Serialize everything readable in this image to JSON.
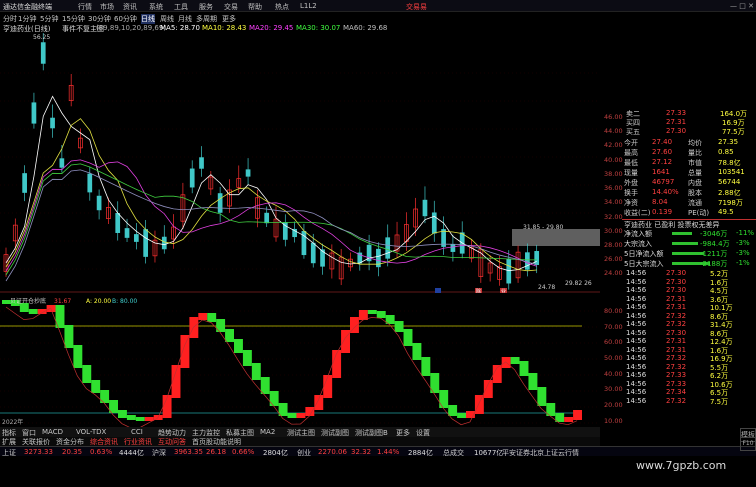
{
  "titlebar": {
    "app": "通达信金融终端",
    "menus": [
      "行情",
      "市场",
      "资讯",
      "系统",
      "工具",
      "服务",
      "交易",
      "帮助",
      "热点",
      "L1L2"
    ],
    "trade": "交易易"
  },
  "toolbar": {
    "items": [
      "分时",
      "1分钟",
      "5分钟",
      "15分钟",
      "30分钟",
      "60分钟",
      "日线",
      "周线",
      "月线",
      "多周期",
      "更多"
    ]
  },
  "infobar": {
    "stock": "亨迪药业(日线)",
    "mode": "事件不复主图",
    "params": "(89,89,10,20,89,69)",
    "ma5": "MA5: 28.70",
    "ma10": "MA10: 28.43",
    "ma20": "MA20: 29.45",
    "ma30": "MA30: 30.07",
    "ma60": "MA60: 29.68",
    "high_label": "56.25"
  },
  "axis": {
    "price": [
      "46.00",
      "44.00",
      "42.00",
      "40.00",
      "38.00",
      "36.00",
      "34.00",
      "32.00",
      "30.00",
      "28.00",
      "26.00",
      "24.00"
    ],
    "ind": [
      "80.00",
      "70.00",
      "60.00",
      "50.00",
      "40.00",
      "30.00",
      "20.00",
      "10.00"
    ],
    "extra": "29.82 26"
  },
  "annotations": {
    "range": "31.85 - 29.80",
    "low": "24.78",
    "marks": [
      "日",
      "除",
      "业"
    ]
  },
  "quote": {
    "asks": [
      {
        "l": "卖二",
        "p": "27.33",
        "v": "164.0万"
      },
      {
        "l": "买四",
        "p": "27.31",
        "v": "16.9万"
      },
      {
        "l": "买五",
        "p": "27.30",
        "v": "77.5万"
      }
    ],
    "rows": [
      {
        "a": "今开",
        "b": "27.40",
        "c": "均价",
        "d": "27.35"
      },
      {
        "a": "最高",
        "b": "27.60",
        "c": "量比",
        "d": "0.85"
      },
      {
        "a": "最低",
        "b": "27.12",
        "c": "市值",
        "d": "78.8亿"
      },
      {
        "a": "现量",
        "b": "1641",
        "c": "总量",
        "d": "103541"
      },
      {
        "a": "外盘",
        "b": "46797",
        "c": "内盘",
        "d": "56744"
      },
      {
        "a": "换手",
        "b": "14.40%",
        "c": "股本",
        "d": "2.88亿"
      },
      {
        "a": "净资",
        "b": "8.04",
        "c": "流通",
        "d": "7198万"
      },
      {
        "a": "收益(二)",
        "b": "0.139",
        "c": "PE(动)",
        "d": "49.5"
      }
    ],
    "company": "亨迪药业 已盈利 投票权无差异",
    "flows": [
      {
        "l": "净流入额",
        "v": "-3046万",
        "p": "-11%"
      },
      {
        "l": "大宗流入",
        "v": "-984.4万",
        "p": "-3%"
      },
      {
        "l": "5日净流入额",
        "v": "-1211万",
        "p": "-3%"
      },
      {
        "l": "5日大宗流入",
        "v": "-2188万",
        "p": "-1%"
      }
    ],
    "ticks": [
      {
        "t": "14:56",
        "p": "27.30",
        "v": "5.2万"
      },
      {
        "t": "14:56",
        "p": "27.30",
        "v": "1.6万"
      },
      {
        "t": "14:56",
        "p": "27.30",
        "v": "4.5万"
      },
      {
        "t": "14:56",
        "p": "27.31",
        "v": "3.6万"
      },
      {
        "t": "14:56",
        "p": "27.31",
        "v": "10.1万"
      },
      {
        "t": "14:56",
        "p": "27.32",
        "v": "8.6万"
      },
      {
        "t": "14:56",
        "p": "27.32",
        "v": "31.4万"
      },
      {
        "t": "14:56",
        "p": "27.30",
        "v": "8.6万"
      },
      {
        "t": "14:56",
        "p": "27.31",
        "v": "12.4万"
      },
      {
        "t": "14:56",
        "p": "27.31",
        "v": "1.6万"
      },
      {
        "t": "14:56",
        "p": "27.32",
        "v": "16.9万"
      },
      {
        "t": "14:56",
        "p": "27.32",
        "v": "5.5万"
      },
      {
        "t": "14:56",
        "p": "27.33",
        "v": "6.2万"
      },
      {
        "t": "14:56",
        "p": "27.33",
        "v": "10.6万"
      },
      {
        "t": "14:56",
        "p": "27.34",
        "v": "6.5万"
      },
      {
        "t": "14:56",
        "p": "27.32",
        "v": "7.5万"
      }
    ]
  },
  "indicator": {
    "name": "贝证开仓抄底",
    "a": "A: 20.00",
    "b": "B: 80.00",
    "val": "31.67"
  },
  "tabs": [
    "指标",
    "窗口",
    "MACD",
    "VOL-TDX",
    "CCI",
    "趋势动力",
    "主力监控",
    "私募主图",
    "MA2",
    "测试主图",
    "测试副图",
    "测试副图B",
    "更多",
    "设置"
  ],
  "tabs2": [
    "扩展",
    "关联报价",
    "资金分布",
    "综合资讯",
    "行业资讯",
    "互动问答",
    "首页股动能说明"
  ],
  "year": "2022年",
  "status": [
    {
      "l": "上证",
      "v": "3273.33",
      "c": "20.35",
      "p": "0.63%",
      "a": "4444亿"
    },
    {
      "l": "沪深",
      "v": "3963.35",
      "c": "26.18",
      "p": "0.66%",
      "a": "2804亿"
    },
    {
      "l": "创业",
      "v": "2270.06",
      "c": "32.32",
      "p": "1.44%",
      "a": "2884亿"
    }
  ],
  "status_extra": {
    "total": "总成交",
    "amount": "10677亿",
    "note": "平安证券北京上证云行情"
  },
  "watermark": "www.7gpzb.com",
  "side": [
    "模板",
    "F10"
  ]
}
